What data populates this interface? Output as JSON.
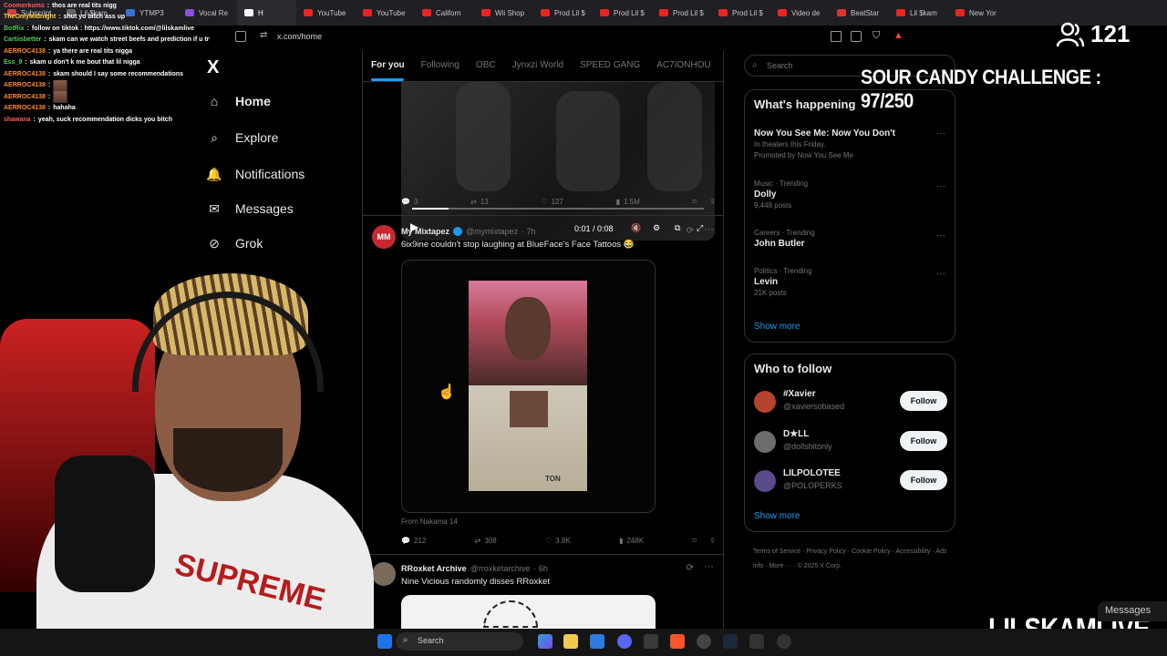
{
  "browser": {
    "tabs": [
      {
        "label": "Subscript",
        "color": "#c44"
      },
      {
        "label": "Lil $kam",
        "color": "#666"
      },
      {
        "label": "YTMP3",
        "color": "#3a6fd8"
      },
      {
        "label": "Vocal Re",
        "color": "#8a4fd8"
      },
      {
        "label": "H",
        "color": "#fff",
        "active": true
      },
      {
        "label": "YouTube",
        "color": "#e22"
      },
      {
        "label": "YouTube",
        "color": "#e22"
      },
      {
        "label": "Californ",
        "color": "#e22"
      },
      {
        "label": "Wii Shop",
        "color": "#e22"
      },
      {
        "label": "Prod Lil $",
        "color": "#e22"
      },
      {
        "label": "Prod Lil $",
        "color": "#e22"
      },
      {
        "label": "Prod Lil $",
        "color": "#e22"
      },
      {
        "label": "Prod Lil $",
        "color": "#e22"
      },
      {
        "label": "Video de",
        "color": "#e22"
      },
      {
        "label": "BeatStar",
        "color": "#d33"
      },
      {
        "label": "Lil $kam",
        "color": "#e22"
      },
      {
        "label": "New Yor",
        "color": "#e22"
      }
    ],
    "url": "x.com/home"
  },
  "chat": [
    {
      "name": "Coomerkums",
      "color": "#ff5a5a",
      "msg": "thos are real tits nigg"
    },
    {
      "name": "TheOnlyMidnight",
      "color": "#ffd23a",
      "msg": "shut yo bitch ass up"
    },
    {
      "name": "BotRix",
      "color": "#52d452",
      "msg": "follow on tiktok : https://www.tiktok.com/@lilskamlive"
    },
    {
      "name": "Cartiisbetter",
      "color": "#52d452",
      "msg": "skam can we watch street beefs and prediction if u truly love sig"
    },
    {
      "name": "AERROC4138",
      "color": "#ff8a2a",
      "msg": "ya there are real tits nigga"
    },
    {
      "name": "Ess_9",
      "color": "#52d452",
      "msg": "skam u don't k me bout that lil nigga"
    },
    {
      "name": "AERROC4138",
      "color": "#ff8a2a",
      "msg": "skam should I say some recommendations"
    },
    {
      "name": "AERROC4138",
      "color": "#ff8a2a",
      "msg": "",
      "thumb": true
    },
    {
      "name": "AERROC4138",
      "color": "#ff8a2a",
      "msg": "",
      "thumb": true
    },
    {
      "name": "AERROC4138",
      "color": "#ff8a2a",
      "msg": "hahaha"
    },
    {
      "name": "shawana",
      "color": "#ff5a5a",
      "msg": "yeah, suck recommendation dicks you bitch"
    }
  ],
  "nav": {
    "logo": "X",
    "items": [
      {
        "label": "Home",
        "icon": "home-icon",
        "glyph": "⌂"
      },
      {
        "label": "Explore",
        "icon": "search-icon",
        "glyph": "⌕"
      },
      {
        "label": "Notifications",
        "icon": "bell-icon",
        "glyph": "🔔"
      },
      {
        "label": "Messages",
        "icon": "envelope-icon",
        "glyph": "✉"
      },
      {
        "label": "Grok",
        "icon": "grok-icon",
        "glyph": "⊘"
      }
    ]
  },
  "feed": {
    "tabs": [
      "For you",
      "Following",
      "OBC",
      "Jynxzi World",
      "SPEED GANG",
      "AC7IONHOU"
    ],
    "video": {
      "time": "0:01 / 0:08",
      "progress": 0.125
    },
    "video_stats": {
      "replies": "3",
      "reposts": "13",
      "likes": "127",
      "views": "1.5M"
    },
    "post1": {
      "name": "My Mixtapez",
      "handle": "@mymixtapez",
      "time": "· 7h",
      "text": "6ix9ine couldn't stop laughing at BlueFace's Face Tattoos 😂",
      "source": "From Nakama 14",
      "media_caption": "TON",
      "replies": "212",
      "reposts": "308",
      "likes": "3.8K",
      "views": "248K"
    },
    "post2": {
      "name": "RRoxket Archive",
      "handle": "@rroxketarchive",
      "time": "· 6h",
      "text": "Nine Vicious randomly disses RRoxket"
    }
  },
  "right": {
    "search_placeholder": "Search",
    "happening": {
      "title": "What's happening",
      "trends": [
        {
          "meta": "",
          "name": "Now You See Me: Now You Don't",
          "sub": "In theaters this Friday.",
          "promo": "Promoted by Now You See Me"
        },
        {
          "meta": "Music · Trending",
          "name": "Dolly",
          "sub": "9,448 posts"
        },
        {
          "meta": "Careers · Trending",
          "name": "John Butler",
          "sub": ""
        },
        {
          "meta": "Politics · Trending",
          "name": "Levin",
          "sub": "21K posts"
        }
      ],
      "show_more": "Show more"
    },
    "who_to_follow": {
      "title": "Who to follow",
      "accounts": [
        {
          "name": "#Xavier",
          "handle": "@xaviersobased",
          "button": "Follow",
          "color": "#b5442e"
        },
        {
          "name": "D★LL",
          "handle": "@dollshitonly",
          "button": "Follow",
          "color": "#6d6d6d"
        },
        {
          "name": "LILPOLOTEE",
          "handle": "@POLOPERKS",
          "button": "Follow",
          "color": "#5a4a8a"
        }
      ],
      "show_more": "Show more"
    },
    "footer": [
      "Terms of Service",
      "Privacy Policy",
      "Cookie Policy",
      "Accessibility",
      "Ads info",
      "More ···",
      "© 2025 X Corp."
    ]
  },
  "overlay": {
    "viewer_count": "121",
    "challenge": "SOUR CANDY CHALLENGE : 97/250",
    "channel": "LILSKAMLIVE",
    "messages_tab": "Messages",
    "webcam_shirt": "SUPREME"
  },
  "taskbar": {
    "search": "Search"
  }
}
